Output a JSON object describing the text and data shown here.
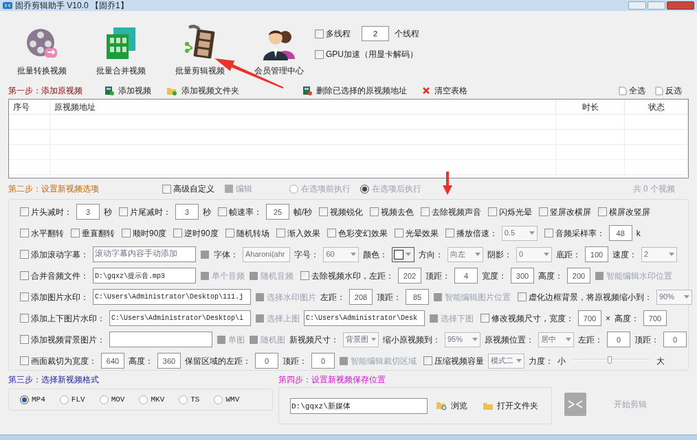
{
  "window": {
    "title": "固乔剪辑助手 V10.0 【固乔1】"
  },
  "toolbar": {
    "buttons": [
      {
        "label": "批量转换视频"
      },
      {
        "label": "批量合并视频"
      },
      {
        "label": "批量剪辑视频"
      },
      {
        "label": "会员管理中心"
      }
    ],
    "threads": {
      "label": "多线程",
      "checked": false,
      "value": "2",
      "unit": "个线程"
    },
    "gpu": {
      "label": "GPU加速（用显卡解码）",
      "checked": false
    }
  },
  "step1": {
    "title": "第一步：添加原视频",
    "actions": [
      {
        "label": "添加视频"
      },
      {
        "label": "添加视频文件夹"
      },
      {
        "label": "删除已选择的原视频地址"
      },
      {
        "label": "清空表格"
      }
    ],
    "select_actions": [
      {
        "label": "全选"
      },
      {
        "label": "反选"
      }
    ]
  },
  "table": {
    "columns": [
      "序号",
      "原视频地址",
      "时长",
      "状态"
    ]
  },
  "step2": {
    "title": "第二步：设置新视频选项",
    "advanced": {
      "label": "高级自定义",
      "checked": false
    },
    "edit": {
      "label": "编辑",
      "disabled": true
    },
    "radios": [
      {
        "label": "在选项前执行",
        "selected": false,
        "disabled": true
      },
      {
        "label": "在选项后执行",
        "selected": true,
        "disabled": true
      }
    ],
    "count": "共 0 个视频"
  },
  "options": {
    "rows": [
      {
        "items": [
          {
            "kind": "check",
            "label": "片头减时：",
            "checked": false
          },
          {
            "kind": "num",
            "value": "3"
          },
          {
            "kind": "label",
            "text": "秒"
          },
          {
            "kind": "check",
            "label": "片尾减时：",
            "checked": false
          },
          {
            "kind": "num",
            "value": "3"
          },
          {
            "kind": "label",
            "text": "秒"
          },
          {
            "kind": "check",
            "label": "帧速率：",
            "checked": false
          },
          {
            "kind": "num",
            "value": "25"
          },
          {
            "kind": "label",
            "text": "帧/秒"
          },
          {
            "kind": "check",
            "label": "视频锐化",
            "checked": false
          },
          {
            "kind": "check",
            "label": "视频去色",
            "checked": false
          },
          {
            "kind": "check",
            "label": "去除视频声音",
            "checked": false
          },
          {
            "kind": "check",
            "label": "闪烁光晕",
            "checked": false
          },
          {
            "kind": "check",
            "label": "竖屏改横屏",
            "checked": false
          },
          {
            "kind": "check",
            "label": "横屏改竖屏",
            "checked": false
          }
        ]
      },
      {
        "items": [
          {
            "kind": "check",
            "label": "水平翻转",
            "checked": false
          },
          {
            "kind": "check",
            "label": "垂直翻转",
            "checked": false
          },
          {
            "kind": "check",
            "label": "顺时90度",
            "checked": false
          },
          {
            "kind": "check",
            "label": "逆时90度",
            "checked": false
          },
          {
            "kind": "check",
            "label": "随机转场",
            "checked": false
          },
          {
            "kind": "check",
            "label": "渐入效果",
            "checked": false
          },
          {
            "kind": "check",
            "label": "色彩变幻效果",
            "checked": false
          },
          {
            "kind": "check",
            "label": "光晕效果",
            "checked": false
          },
          {
            "kind": "check",
            "label": "播放倍速：",
            "checked": false
          },
          {
            "kind": "select",
            "value": "0.5"
          },
          {
            "kind": "check",
            "label": "音频采样率：",
            "checked": false
          },
          {
            "kind": "num",
            "value": "48"
          },
          {
            "kind": "label",
            "text": "k"
          }
        ]
      },
      {
        "items": [
          {
            "kind": "check",
            "label": "添加滚动字幕：",
            "checked": false
          },
          {
            "kind": "text",
            "placeholder": "滚动字幕内容手动添加"
          },
          {
            "kind": "tool",
            "disabled": true
          },
          {
            "kind": "label",
            "text": "字体："
          },
          {
            "kind": "select",
            "value": "Aharoni(ahr"
          },
          {
            "kind": "label",
            "text": "字号："
          },
          {
            "kind": "select",
            "value": "60"
          },
          {
            "kind": "label",
            "text": "颜色："
          },
          {
            "kind": "swatch"
          },
          {
            "kind": "label",
            "text": "方向："
          },
          {
            "kind": "select",
            "value": "向左"
          },
          {
            "kind": "label",
            "text": "阴影："
          },
          {
            "kind": "select",
            "value": "0"
          },
          {
            "kind": "label",
            "text": "底距："
          },
          {
            "kind": "num",
            "value": "100"
          },
          {
            "kind": "label",
            "text": "速度："
          },
          {
            "kind": "select",
            "value": "2"
          }
        ]
      },
      {
        "items": [
          {
            "kind": "check",
            "label": "合并音频文件：",
            "checked": false
          },
          {
            "kind": "text",
            "value": "D:\\gqxz\\提示音.mp3"
          },
          {
            "kind": "tool",
            "label": "单个音频",
            "disabled": true
          },
          {
            "kind": "tool",
            "label": "随机音频",
            "disabled": true
          },
          {
            "kind": "check",
            "label": "去除视频水印，左距：",
            "checked": false
          },
          {
            "kind": "num",
            "value": "202"
          },
          {
            "kind": "label",
            "text": "顶距："
          },
          {
            "kind": "num",
            "value": "4"
          },
          {
            "kind": "label",
            "text": "宽度："
          },
          {
            "kind": "num",
            "value": "300"
          },
          {
            "kind": "label",
            "text": "高度："
          },
          {
            "kind": "num",
            "value": "200"
          },
          {
            "kind": "tool",
            "label": "智能编辑水印位置",
            "disabled": true
          }
        ]
      },
      {
        "items": [
          {
            "kind": "check",
            "label": "添加图片水印：",
            "checked": false
          },
          {
            "kind": "text",
            "value": "C:\\Users\\Administrator\\Desktop\\111.j"
          },
          {
            "kind": "tool",
            "label": "选择水印图片",
            "disabled": true
          },
          {
            "kind": "label",
            "text": "左距："
          },
          {
            "kind": "num",
            "value": "208"
          },
          {
            "kind": "label",
            "text": "顶距："
          },
          {
            "kind": "num",
            "value": "85"
          },
          {
            "kind": "tool",
            "label": "智能编辑图片位置",
            "disabled": true
          },
          {
            "kind": "check",
            "label": "虚化边框背景，将原视频缩小到：",
            "checked": false
          },
          {
            "kind": "select",
            "value": "90%"
          }
        ]
      },
      {
        "items": [
          {
            "kind": "check",
            "label": "添加上下图片水印：",
            "checked": false
          },
          {
            "kind": "text",
            "value": "C:\\Users\\Administrator\\Desktop\\i"
          },
          {
            "kind": "tool",
            "label": "选择上图",
            "disabled": true
          },
          {
            "kind": "text",
            "value": "C:\\Users\\Administrator\\Desk"
          },
          {
            "kind": "tool",
            "label": "选择下图",
            "disabled": true
          },
          {
            "kind": "check",
            "label": "修改视频尺寸，宽度：",
            "checked": false
          },
          {
            "kind": "num",
            "value": "700"
          },
          {
            "kind": "label",
            "text": "×"
          },
          {
            "kind": "label",
            "text": "高度："
          },
          {
            "kind": "num",
            "value": "700"
          }
        ]
      },
      {
        "items": [
          {
            "kind": "check",
            "label": "添加视频背景图片：",
            "checked": false
          },
          {
            "kind": "text"
          },
          {
            "kind": "tool",
            "label": "单图",
            "disabled": true
          },
          {
            "kind": "tool",
            "label": "随机图",
            "disabled": true
          },
          {
            "kind": "label",
            "text": "新视频尺寸："
          },
          {
            "kind": "select",
            "value": "背景图"
          },
          {
            "kind": "label",
            "text": "缩小原视频到："
          },
          {
            "kind": "select",
            "value": "95%"
          },
          {
            "kind": "label",
            "text": "原视频位置："
          },
          {
            "kind": "select",
            "value": "居中"
          },
          {
            "kind": "label",
            "text": "左距："
          },
          {
            "kind": "num",
            "value": "0"
          },
          {
            "kind": "label",
            "text": "顶距："
          },
          {
            "kind": "num",
            "value": "0"
          }
        ]
      },
      {
        "items": [
          {
            "kind": "check",
            "label": "画面裁切为宽度：",
            "checked": false
          },
          {
            "kind": "num",
            "value": "640"
          },
          {
            "kind": "label",
            "text": "高度："
          },
          {
            "kind": "num",
            "value": "360"
          },
          {
            "kind": "label",
            "text": "保留区域的左距："
          },
          {
            "kind": "num",
            "value": "0"
          },
          {
            "kind": "label",
            "text": "顶距："
          },
          {
            "kind": "num",
            "value": "0"
          },
          {
            "kind": "tool",
            "label": "智能编辑裁切区域",
            "disabled": true
          },
          {
            "kind": "check",
            "label": "压缩视频容量",
            "checked": false
          },
          {
            "kind": "select",
            "value": "模式二"
          },
          {
            "kind": "label",
            "text": "力度："
          },
          {
            "kind": "label",
            "text": "小"
          },
          {
            "kind": "slider",
            "level": 0.48
          },
          {
            "kind": "label",
            "text": "大"
          }
        ]
      }
    ]
  },
  "step3": {
    "title": "第三步：选择新视频格式",
    "formats": [
      {
        "label": "MP4",
        "selected": true
      },
      {
        "label": "FLV",
        "selected": false
      },
      {
        "label": "MOV",
        "selected": false
      },
      {
        "label": "MKV",
        "selected": false
      },
      {
        "label": "TS",
        "selected": false
      },
      {
        "label": "WMV",
        "selected": false
      }
    ]
  },
  "step4": {
    "title": "第四步：设置新视频保存位置",
    "path": "D:\\gqxz\\新媒体",
    "buttons": [
      {
        "label": "浏览"
      },
      {
        "label": "打开文件夹"
      }
    ],
    "start": {
      "label": "开始剪辑",
      "disabled": true
    }
  }
}
